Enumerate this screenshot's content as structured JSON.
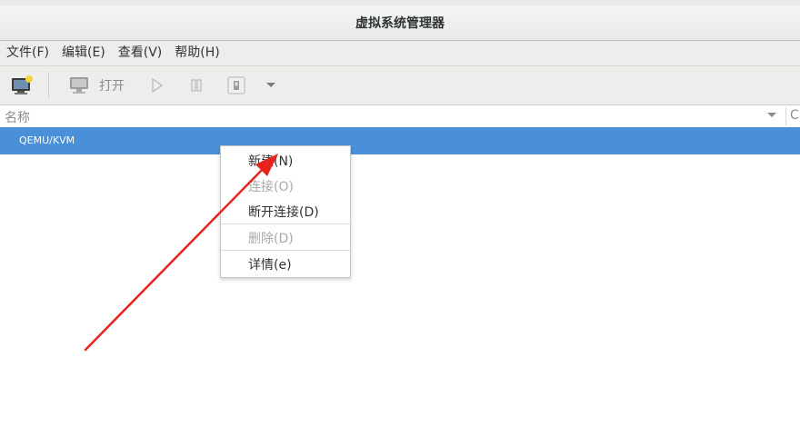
{
  "window": {
    "title": "虚拟系统管理器"
  },
  "menubar": {
    "items": [
      "文件(F)",
      "编辑(E)",
      "查看(V)",
      "帮助(H)"
    ]
  },
  "toolbar": {
    "open_label": "打开"
  },
  "table": {
    "columns": [
      "名称",
      "C"
    ],
    "rows": [
      {
        "name": "QEMU/KVM",
        "selected": true
      }
    ]
  },
  "context_menu": {
    "items": [
      {
        "label": "新建(N)",
        "enabled": true
      },
      {
        "label": "连接(O)",
        "enabled": false
      },
      {
        "label": "断开连接(D)",
        "enabled": true
      },
      {
        "label": "删除(D)",
        "enabled": false
      },
      {
        "label": "详情(e)",
        "enabled": true
      }
    ]
  },
  "colors": {
    "selection": "#4a90d9",
    "annotation_arrow": "#e8231d"
  },
  "icons": [
    "new-connection-icon",
    "monitor-icon",
    "play-icon",
    "pause-icon",
    "power-icon",
    "dropdown-arrow-icon",
    "sort-arrow-icon"
  ]
}
